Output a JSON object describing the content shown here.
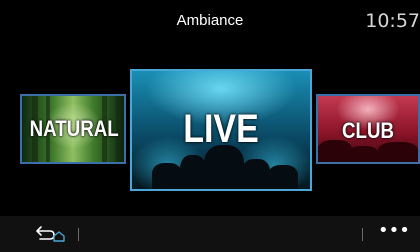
{
  "header": {
    "title": "Ambiance",
    "clock": "10:57"
  },
  "ambiances": [
    {
      "label": "NATURAL",
      "selected": false,
      "border_color": "#3b6fa8"
    },
    {
      "label": "LIVE",
      "selected": true,
      "border_color": "#4aa7d8"
    },
    {
      "label": "CLUB",
      "selected": false,
      "border_color": "#3b6fa8"
    }
  ],
  "bottom_bar": {
    "back_icon": "back-arrow-home-icon",
    "more_label": "•••"
  },
  "colors": {
    "background": "#000000",
    "bottom_bar": "#111111",
    "selection_border": "#4aa7d8"
  }
}
